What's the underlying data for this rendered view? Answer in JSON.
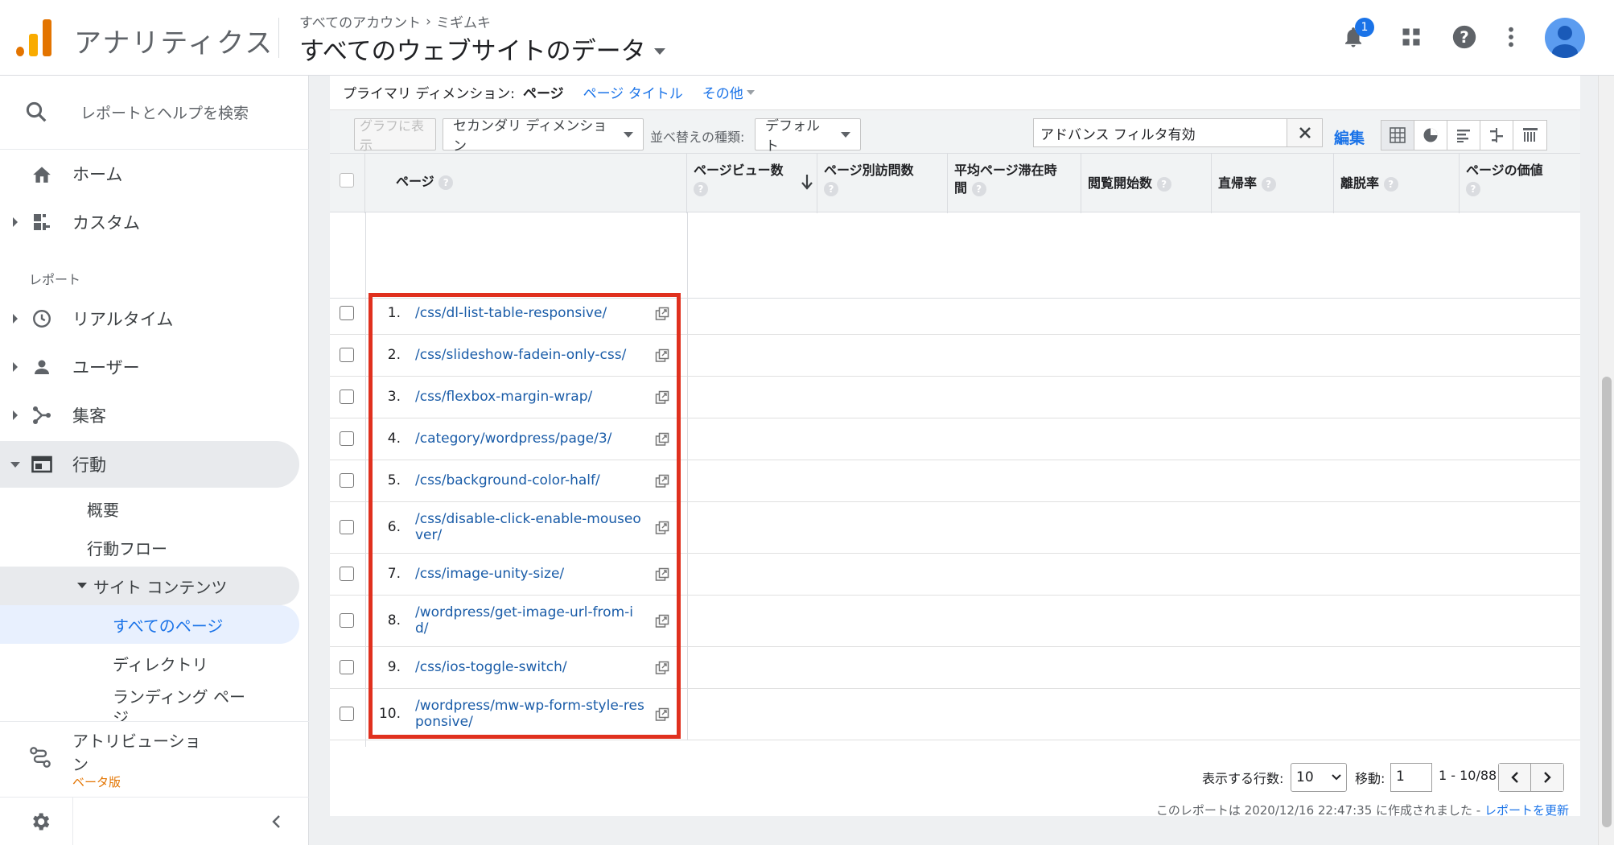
{
  "header": {
    "app_name": "アナリティクス",
    "breadcrumb": [
      "すべてのアカウント",
      "ミギムキ"
    ],
    "breadcrumb_sep": "›",
    "property": "すべてのウェブサイトのデータ",
    "notification_count": "1",
    "brand_colors": {
      "logo_orange": "#f9ab00",
      "logo_dark": "#e37400",
      "accent": "#1a73e8"
    }
  },
  "sidebar": {
    "search_placeholder": "レポートとヘルプを検索",
    "top_items": [
      {
        "label": "ホーム",
        "icon": "home-icon"
      },
      {
        "label": "カスタム",
        "icon": "dashboard-icon"
      }
    ],
    "section_label": "レポート",
    "report_items": [
      {
        "label": "リアルタイム",
        "icon": "clock-icon"
      },
      {
        "label": "ユーザー",
        "icon": "person-icon"
      },
      {
        "label": "集客",
        "icon": "acquisition-icon"
      },
      {
        "label": "行動",
        "icon": "behavior-icon"
      }
    ],
    "behavior_children": [
      "概要",
      "行動フロー"
    ],
    "site_content": "サイト コンテンツ",
    "site_content_children": [
      "すべてのページ",
      "ディレクトリ",
      "ランディング ペー",
      "ジ"
    ],
    "attribution": {
      "line1": "アトリビューショ",
      "line2": "ン",
      "beta": "ベータ版"
    }
  },
  "dimension_bar": {
    "label": "プライマリ ディメンション:",
    "current": "ページ",
    "links": [
      "ページ タイトル",
      "その他"
    ]
  },
  "toolbar": {
    "graph_button": "グラフに表示",
    "secondary_dimension": "セカンダリ ディメンション",
    "sort_label": "並べ替えの種類:",
    "sort_value": "デフォルト",
    "filter_value": "アドバンス フィルタ有効",
    "edit": "編集"
  },
  "table": {
    "columns": [
      {
        "label": "ページ"
      },
      {
        "label": "ページビュー数"
      },
      {
        "label": "ページ別訪問数"
      },
      {
        "label": "平均ページ滞在時",
        "label2": "間"
      },
      {
        "label": "閲覧開始数"
      },
      {
        "label": "直帰率"
      },
      {
        "label": "離脱率"
      },
      {
        "label": "ページの価値"
      }
    ],
    "help_glyph": "?",
    "rows": [
      {
        "num": "1.",
        "path": "/css/dl-list-table-responsive/"
      },
      {
        "num": "2.",
        "path": "/css/slideshow-fadein-only-css/"
      },
      {
        "num": "3.",
        "path": "/css/flexbox-margin-wrap/"
      },
      {
        "num": "4.",
        "path": "/category/wordpress/page/3/"
      },
      {
        "num": "5.",
        "path": "/css/background-color-half/"
      },
      {
        "num": "6.",
        "path": "/css/disable-click-enable-mouseo",
        "path2": "ver/"
      },
      {
        "num": "7.",
        "path": "/css/image-unity-size/"
      },
      {
        "num": "8.",
        "path": "/wordpress/get-image-url-from-i",
        "path2": "d/"
      },
      {
        "num": "9.",
        "path": "/css/ios-toggle-switch/"
      },
      {
        "num": "10.",
        "path": "/wordpress/mw-wp-form-style-res",
        "path2": "ponsive/"
      }
    ]
  },
  "pager": {
    "rows_label": "表示する行数:",
    "rows_value": "10",
    "goto_label": "移動:",
    "goto_value": "1",
    "range": "1 - 10/88",
    "report_note": "このレポートは 2020/12/16 22:47:35 に作成されました -",
    "refresh_link": "レポートを更新"
  }
}
